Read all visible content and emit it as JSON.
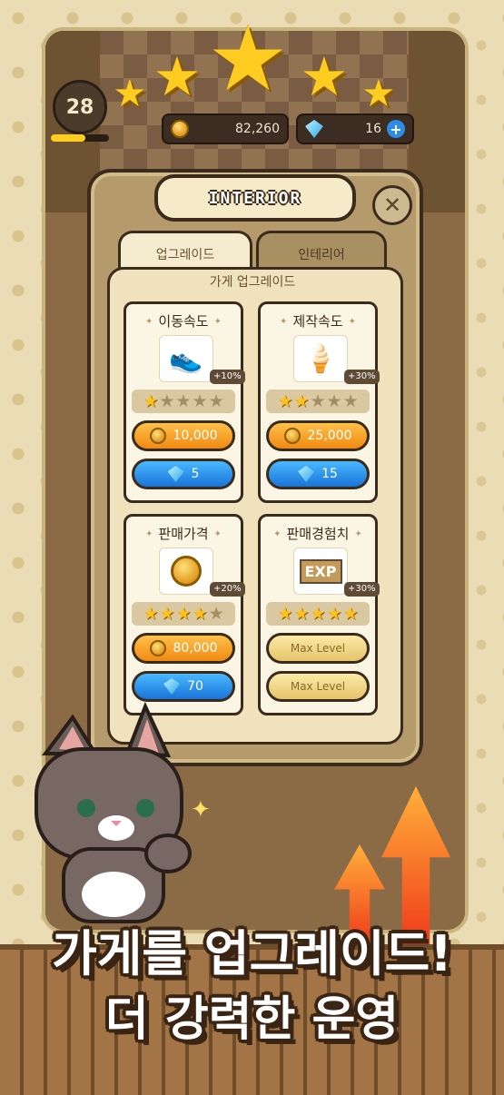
{
  "hud": {
    "level": "28",
    "coins": "82,260",
    "gems": "16"
  },
  "panel": {
    "title": "INTERIOR",
    "tabs": [
      {
        "label": "업그레이드",
        "active": true
      },
      {
        "label": "인테리어",
        "active": false
      }
    ],
    "section_title": "가게 업그레이드",
    "cards": [
      {
        "title": "이동속도",
        "icon": "sneaker-icon",
        "bonus": "+10%",
        "stars_filled": 1,
        "stars_total": 5,
        "coin_cost": "10,000",
        "gem_cost": "5"
      },
      {
        "title": "제작속도",
        "icon": "icecream-hourglass-icon",
        "bonus": "+30%",
        "stars_filled": 2,
        "stars_total": 5,
        "coin_cost": "25,000",
        "gem_cost": "15"
      },
      {
        "title": "판매가격",
        "icon": "coins-icon",
        "bonus": "+20%",
        "stars_filled": 4,
        "stars_total": 5,
        "coin_cost": "80,000",
        "gem_cost": "70"
      },
      {
        "title": "판매경험치",
        "icon": "exp-icon",
        "icon_text": "EXP",
        "bonus": "+30%",
        "stars_filled": 5,
        "stars_total": 5,
        "max_label_1": "Max Level",
        "max_label_2": "Max Level"
      }
    ]
  },
  "headline": {
    "line1": "가게를 업그레이드!",
    "line2": "더 강력한 운영"
  },
  "colors": {
    "coin": "#f5a623",
    "gem": "#2a8ee8",
    "star": "#ffc21a",
    "panel": "#efe2bc"
  }
}
